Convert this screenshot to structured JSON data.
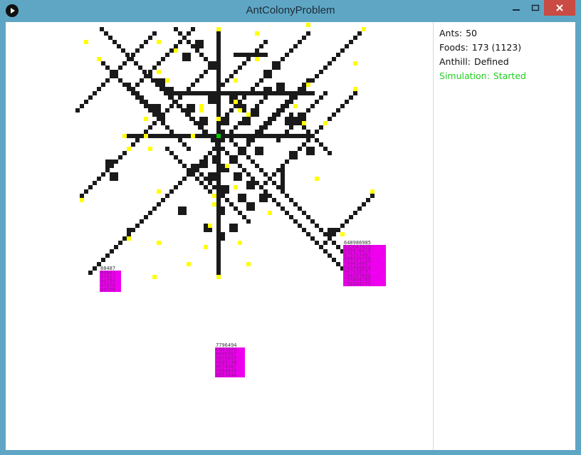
{
  "window": {
    "title": "AntColonyProblem"
  },
  "info": {
    "ants_label": "Ants:",
    "ants_value": "50",
    "foods_label": "Foods:",
    "foods_value": "173 (1123)",
    "anthill_label": "Anthill:",
    "anthill_value": "Defined",
    "simulation_label": "Simulation:",
    "simulation_value": "Started"
  },
  "colors": {
    "title_bar": "#5fa6c5",
    "close_button": "#c94b43",
    "trail": "#1a1a1a",
    "food": "#ffff00",
    "anthill": "#00cc00",
    "food_source": "#ee00ee",
    "status_ok": "#22cc22"
  },
  "food_sources": [
    {
      "name": "food-source-left",
      "header": "88487",
      "rows": [
        "84647",
        "87417",
        "84754",
        "47476",
        "84796"
      ]
    },
    {
      "name": "food-source-right",
      "header": "648986985",
      "rows": [
        "675647679",
        "895476475",
        "675757487",
        "868545756",
        "784454957",
        "565468654",
        "987658797",
        "786597698",
        "754894765",
        "786498775"
      ]
    },
    {
      "name": "food-source-bottom",
      "header": "7796494",
      "rows": [
        "6697675",
        "8446567",
        "6856655",
        "4669748",
        "8674987",
        "9954645",
        "8857644"
      ]
    }
  ]
}
